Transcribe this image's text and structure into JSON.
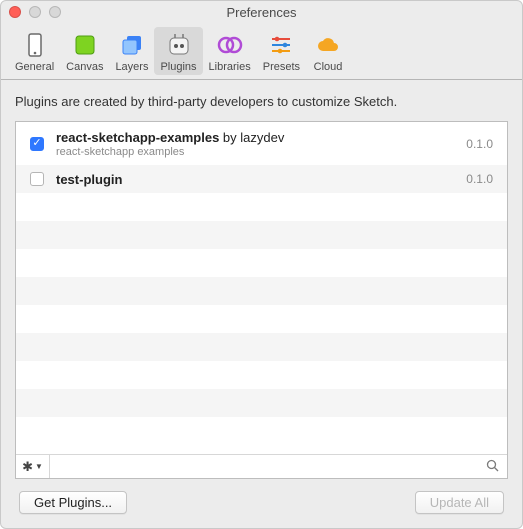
{
  "window": {
    "title": "Preferences"
  },
  "toolbar": {
    "items": [
      {
        "label": "General"
      },
      {
        "label": "Canvas"
      },
      {
        "label": "Layers"
      },
      {
        "label": "Plugins"
      },
      {
        "label": "Libraries"
      },
      {
        "label": "Presets"
      },
      {
        "label": "Cloud"
      }
    ],
    "selected_index": 3
  },
  "description": "Plugins are created by third-party developers to customize Sketch.",
  "plugins": [
    {
      "checked": true,
      "name": "react-sketchapp-examples",
      "author_prefix": " by ",
      "author": "lazydev",
      "subtitle": "react-sketchapp examples",
      "version": "0.1.0"
    },
    {
      "checked": false,
      "name": "test-plugin",
      "author_prefix": "",
      "author": "",
      "subtitle": "",
      "version": "0.1.0"
    }
  ],
  "footer": {
    "get_plugins": "Get Plugins...",
    "update_all": "Update All"
  }
}
